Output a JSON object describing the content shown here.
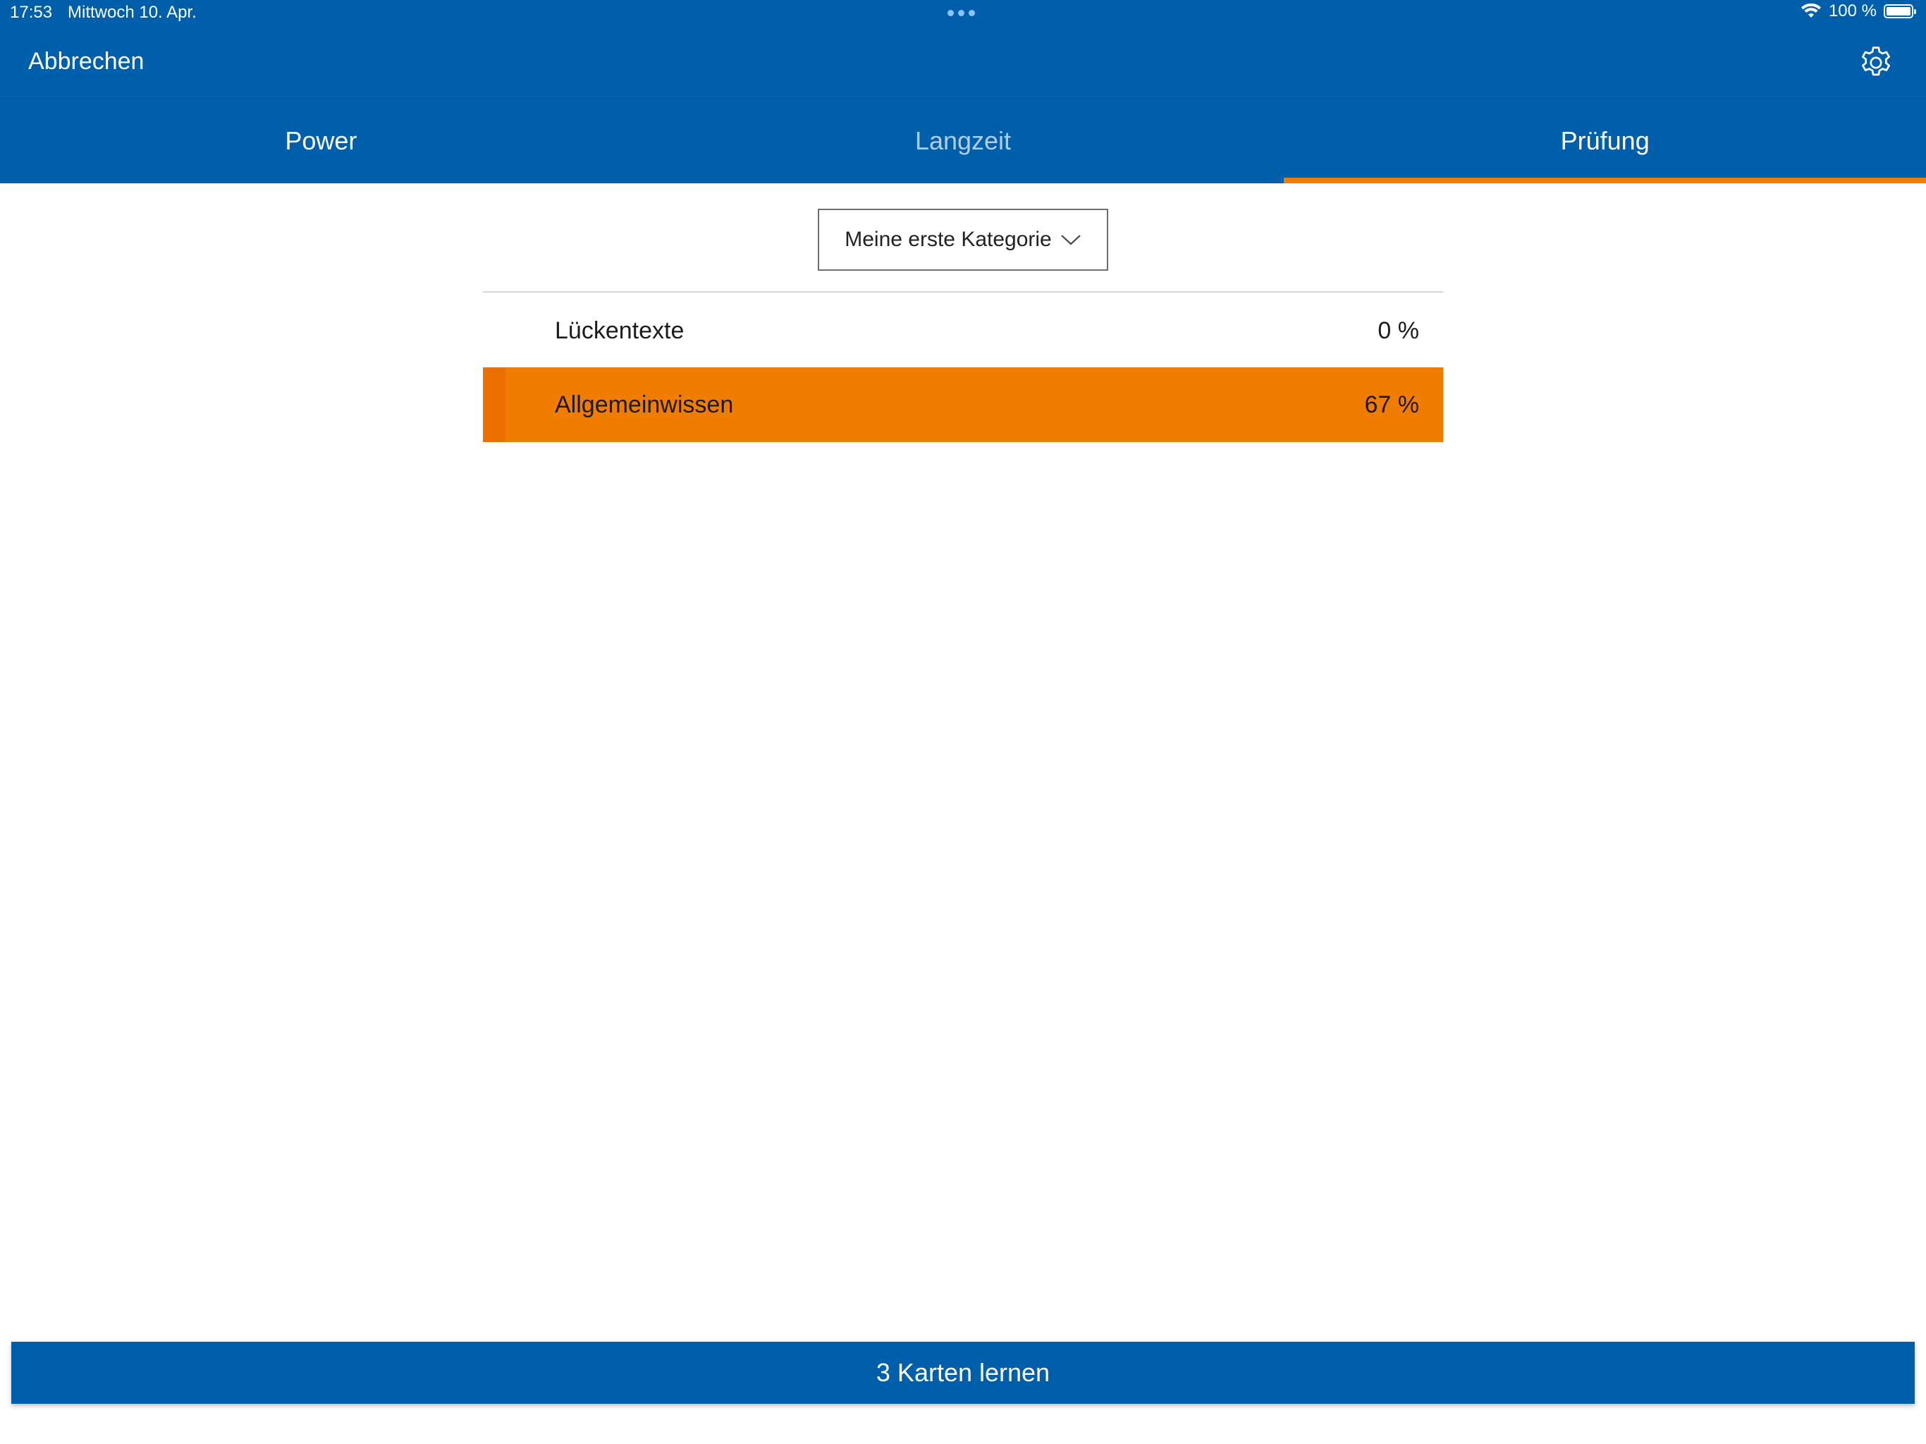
{
  "status_bar": {
    "time": "17:53",
    "date": "Mittwoch 10. Apr.",
    "battery": "100 %",
    "icons": [
      "wifi-icon",
      "battery-icon"
    ]
  },
  "nav": {
    "cancel_label": "Abbrechen",
    "settings_icon": "gear-icon"
  },
  "tabs": [
    {
      "label": "Power",
      "selected": false
    },
    {
      "label": "Langzeit",
      "selected": false
    },
    {
      "label": "Prüfung",
      "selected": true
    }
  ],
  "category_select": {
    "value": "Meine erste Kategorie",
    "icon": "chevron-down-icon"
  },
  "categories": [
    {
      "name": "Lückentexte",
      "percent": "0 %",
      "selected": false
    },
    {
      "name": "Allgemeinwissen",
      "percent": "67 %",
      "selected": true
    }
  ],
  "learn_button": {
    "label": "3 Karten lernen"
  },
  "colors": {
    "primary": "#005fab",
    "accent": "#f07c00",
    "background": "#ffffff"
  }
}
